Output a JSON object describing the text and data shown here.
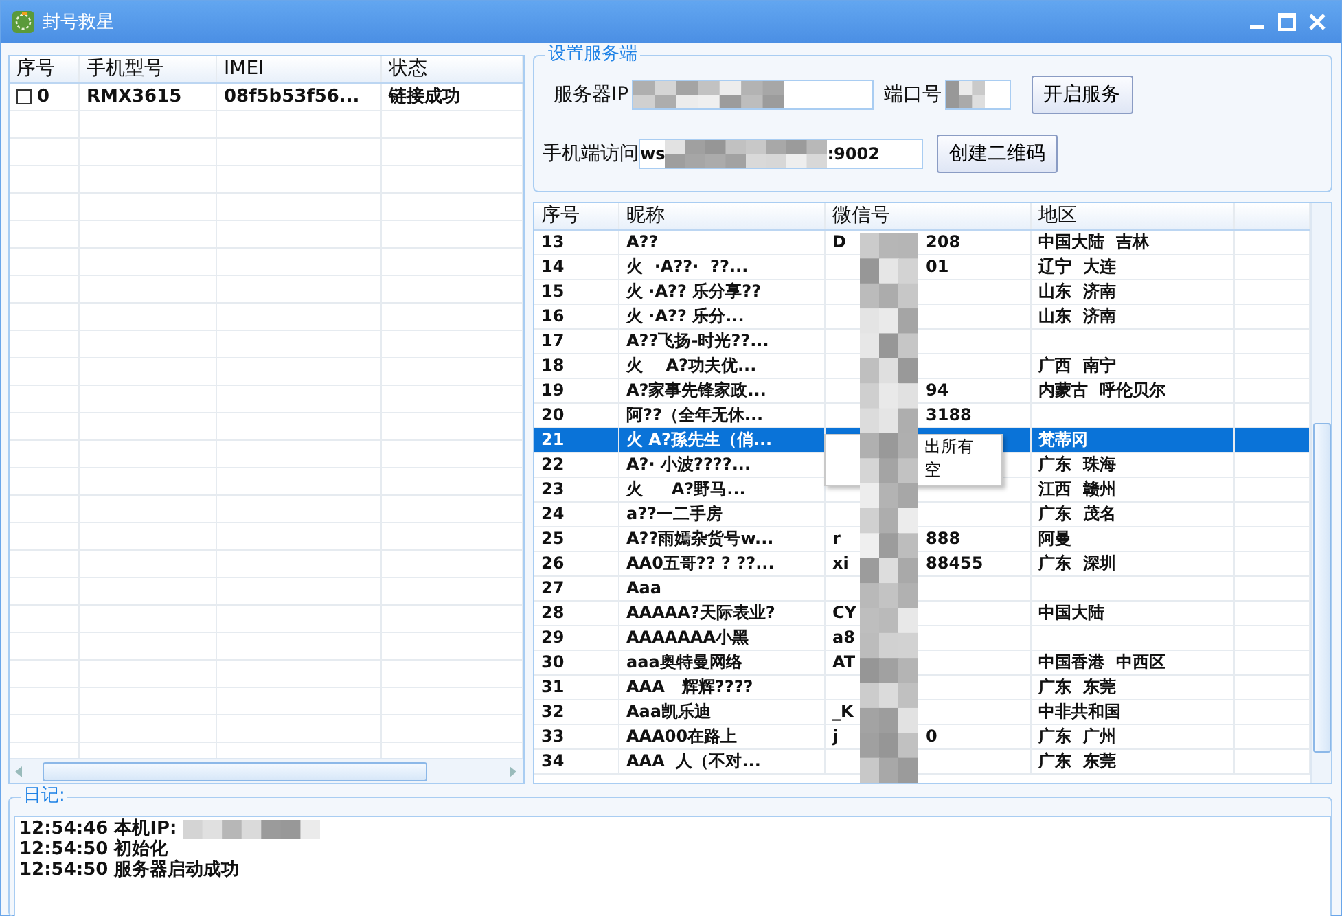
{
  "window": {
    "title": "封号救星"
  },
  "devices": {
    "columns": [
      "序号",
      "手机型号",
      "IMEI",
      "状态"
    ],
    "rows": [
      {
        "index": "0",
        "checked": false,
        "model": "RMX3615",
        "imei": "08f5b53f56...",
        "status": "链接成功"
      }
    ]
  },
  "server": {
    "title": "设置服务端",
    "ip_label": "服务器IP",
    "port_label": "端口号",
    "start_button": "开启服务",
    "url_label": "手机端访问",
    "url_start": "ws",
    "url_end": ":9002",
    "qr_button": "创建二维码"
  },
  "contacts": {
    "columns": [
      "序号",
      "昵称",
      "微信号",
      "地区"
    ],
    "rows": [
      {
        "index": "13",
        "nickname": "A??",
        "wechat_start": "D",
        "wechat_end": "208",
        "region": "中国大陆  吉林",
        "selected": false
      },
      {
        "index": "14",
        "nickname": "火  ·A??·  ??...",
        "wechat_end": "01",
        "region": "辽宁  大连",
        "selected": false
      },
      {
        "index": "15",
        "nickname": "火 ·A?? 乐分享??",
        "region": "山东  济南",
        "selected": false
      },
      {
        "index": "16",
        "nickname": "火 ·A?? 乐分...",
        "region": "山东  济南",
        "selected": false
      },
      {
        "index": "17",
        "nickname": "A??飞扬-时光??...",
        "selected": false
      },
      {
        "index": "18",
        "nickname": "火    A?功夫优...",
        "region": "广西  南宁",
        "selected": false
      },
      {
        "index": "19",
        "nickname": "A?家事先锋家政...",
        "wechat_end": "94",
        "region": "内蒙古  呼伦贝尔",
        "selected": false
      },
      {
        "index": "20",
        "nickname": "阿??（全年无休...",
        "wechat_end": "3188",
        "selected": false
      },
      {
        "index": "21",
        "nickname": "火 A?孫先生（俏...",
        "region": "梵蒂冈",
        "selected": true
      },
      {
        "index": "22",
        "nickname": "A?· 小波????...",
        "region": "广东  珠海",
        "selected": false
      },
      {
        "index": "23",
        "nickname": "火     A?野马...",
        "region": "江西  赣州",
        "selected": false
      },
      {
        "index": "24",
        "nickname": "a??一二手房",
        "region": "广东  茂名",
        "selected": false
      },
      {
        "index": "25",
        "nickname": "A??雨嫣杂货号w...",
        "wechat_start": "r",
        "wechat_end": "888",
        "region": "阿曼",
        "selected": false
      },
      {
        "index": "26",
        "nickname": "AA0五哥?? ? ??...",
        "wechat_start": "xi",
        "wechat_end": "88455",
        "region": "广东  深圳",
        "selected": false
      },
      {
        "index": "27",
        "nickname": "Aaa",
        "selected": false
      },
      {
        "index": "28",
        "nickname": "AAAAA?天际表业?",
        "wechat_start": "CY",
        "region": "中国大陆",
        "selected": false
      },
      {
        "index": "29",
        "nickname": "AAAAAAA小黑",
        "wechat_start": "a8",
        "selected": false
      },
      {
        "index": "30",
        "nickname": "aaa奥特曼网络",
        "wechat_start": "AT",
        "region": "中国香港  中西区",
        "selected": false
      },
      {
        "index": "31",
        "nickname": "AAA   辉辉????",
        "region": "广东  东莞",
        "selected": false
      },
      {
        "index": "32",
        "nickname": "Aaa凯乐迪",
        "wechat_start": "_K",
        "region": "中非共和国",
        "selected": false
      },
      {
        "index": "33",
        "nickname": "AAA00在路上",
        "wechat_start": "j",
        "wechat_end": "0",
        "region": "广东  广州",
        "selected": false
      },
      {
        "index": "34",
        "nickname": "AAA  人（不对...",
        "region": "广东  东莞",
        "selected": false
      }
    ]
  },
  "context_menu": {
    "items": [
      "出所有",
      "空"
    ]
  },
  "log": {
    "title": "日记:",
    "lines": [
      "12:54:46 本机IP:",
      "12:54:50 初始化",
      "12:54:50 服务器启动成功"
    ]
  }
}
